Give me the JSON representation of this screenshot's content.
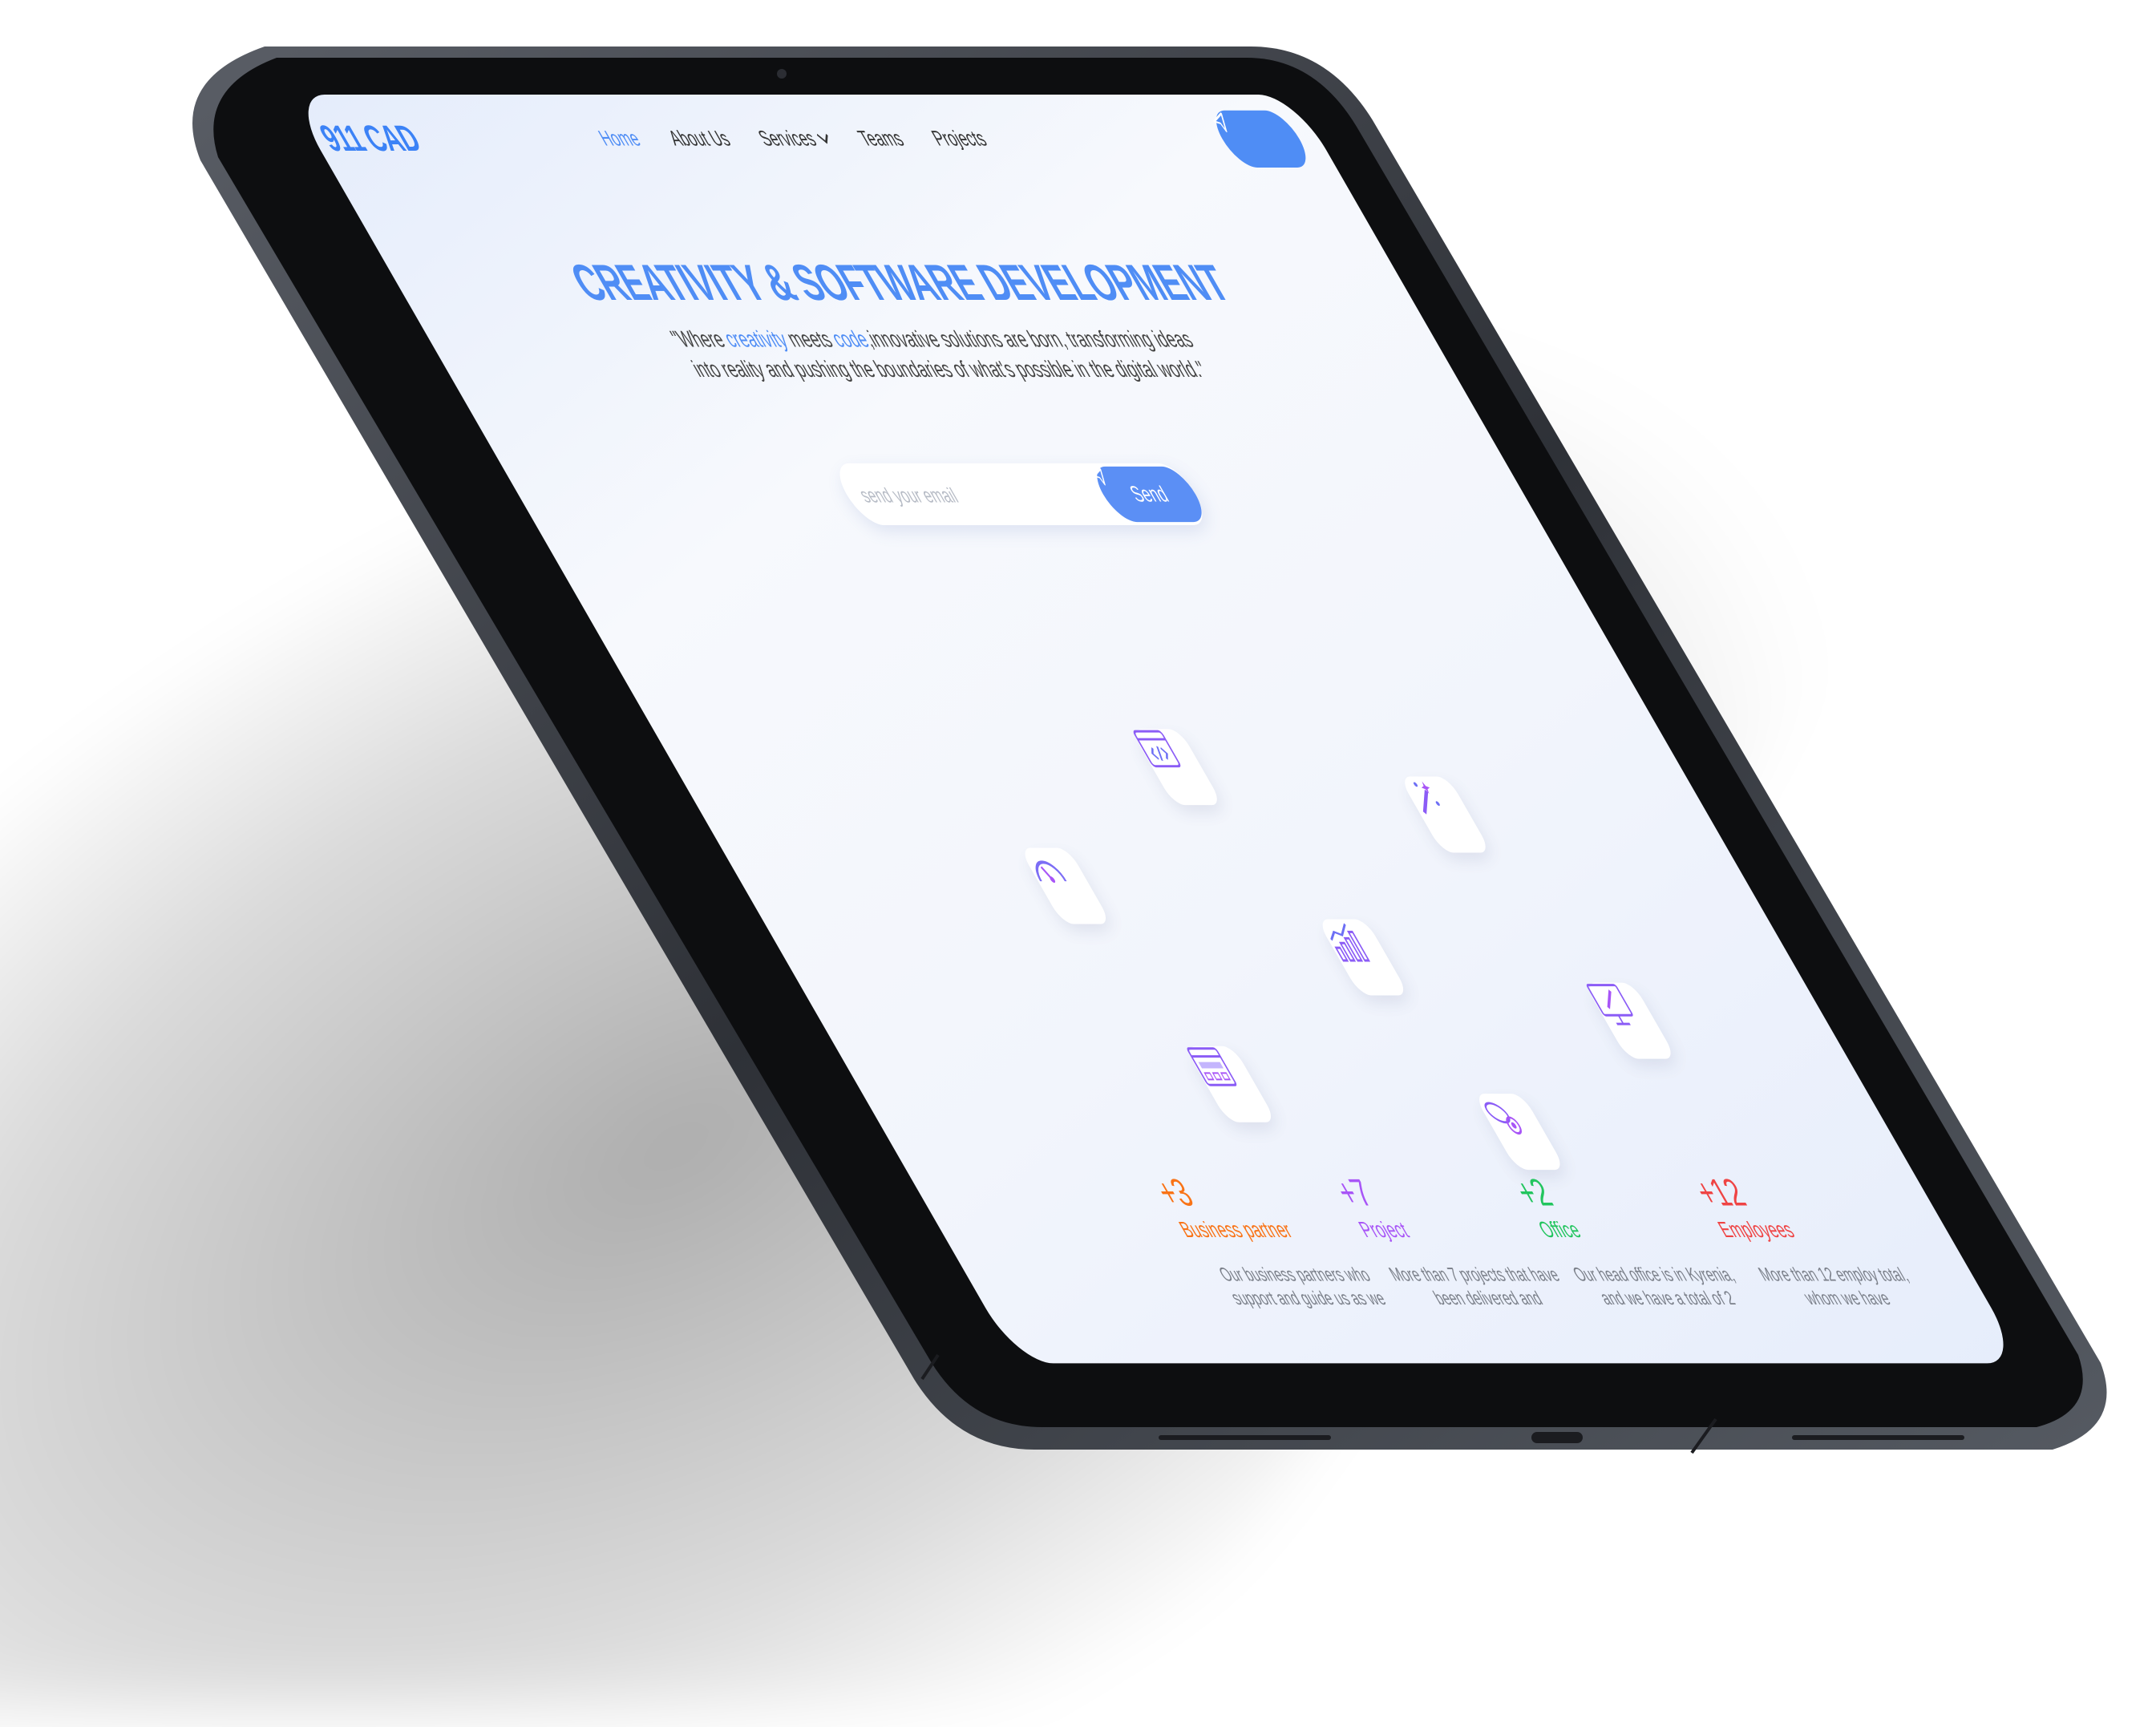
{
  "nav": {
    "logo": "911 CAD",
    "links": [
      {
        "label": "Home"
      },
      {
        "label": "About Us"
      },
      {
        "label": "Services"
      },
      {
        "label": "Teams"
      },
      {
        "label": "Projects"
      }
    ]
  },
  "hero": {
    "title": "CREATIVITY & SOFTWARE DEVELOPMENT",
    "quote_open": "\"Where ",
    "quote_w1": "creativity",
    "quote_mid": "  meets ",
    "quote_w2": "code",
    "quote_rest": ",innovative solutions are born, transforming ideas into reality and pushing the boundaries of what's possible in the digital world.\"",
    "email_placeholder": "send your email",
    "send_label": "Send"
  },
  "icons": [
    "code-window-icon",
    "magic-wand-icon",
    "speedometer-icon",
    "growth-chart-icon",
    "design-monitor-icon",
    "web-layout-icon",
    "rocket-launch-icon"
  ],
  "stats": [
    {
      "num": "+3",
      "label": "Business partner",
      "desc": "Our business partners who support and guide us as we",
      "color": "#f97316"
    },
    {
      "num": "+7",
      "label": "Project",
      "desc": "More than 7 projects that have been delivered and",
      "color": "#a855f7"
    },
    {
      "num": "+2",
      "label": "Office",
      "desc": "Our head office is in Kyrenia, and we have a total of 2",
      "color": "#22c55e"
    },
    {
      "num": "+12",
      "label": "Employees",
      "desc": "More than 12 employ total, whom we have",
      "color": "#ef4444"
    }
  ],
  "colors": {
    "accent": "#4f8df5",
    "frame": "#3a3d44"
  }
}
